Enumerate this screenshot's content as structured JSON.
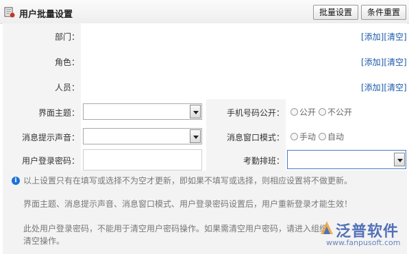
{
  "header": {
    "title": "用户批量设置",
    "batch_button": "批量设置",
    "reset_button": "条件重置"
  },
  "form": {
    "department": {
      "label": "部门：",
      "add": "[添加]",
      "clear": "[清空]"
    },
    "role": {
      "label": "角色：",
      "add": "[添加]",
      "clear": "[清空]"
    },
    "person": {
      "label": "人员：",
      "add": "[添加]",
      "clear": "[清空]"
    },
    "theme": {
      "label": "界面主题：",
      "value": ""
    },
    "phone_public": {
      "label": "手机号码公开：",
      "option1": "公开",
      "option2": "不公开"
    },
    "sound": {
      "label": "消息提示声音：",
      "value": ""
    },
    "window_mode": {
      "label": "消息窗口模式：",
      "option1": "手动",
      "option2": "自动"
    },
    "password": {
      "label": "用户登录密码：",
      "value": ""
    },
    "attendance": {
      "label": "考勤排班：",
      "value": ""
    }
  },
  "notes": {
    "line1": "以上设置只有在填写或选择不为空才更新，即如果不填写或选择，则相应设置将不做更新。",
    "line2": "界面主题、消息提示声音、消息窗口模式、用户登录密码设置后，用户重新登录才能生效！",
    "line3a": "此处用户登录密码，不能用于清空用户密码操作。如果需清空用户密码，请进入组织",
    "line3b": "清空操作。"
  },
  "watermark": {
    "name": "泛普软件",
    "url": "www.fanpusoft.com"
  },
  "colors": {
    "link": "#1a58a8",
    "info": "#1b73d6",
    "label_bg": "#f4f4f4"
  }
}
